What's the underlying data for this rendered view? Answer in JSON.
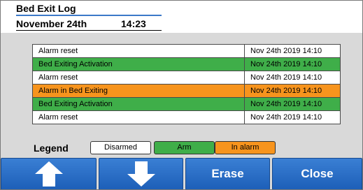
{
  "header": {
    "title": "Bed Exit Log",
    "date": "November 24th",
    "time": "14:23"
  },
  "log": {
    "rows": [
      {
        "event": "Alarm reset",
        "timestamp": "Nov 24th 2019 14:10",
        "status": "disarmed"
      },
      {
        "event": "Bed Exiting Activation",
        "timestamp": "Nov 24th 2019 14:10",
        "status": "arm"
      },
      {
        "event": "Alarm reset",
        "timestamp": "Nov 24th 2019 14:10",
        "status": "disarmed"
      },
      {
        "event": "Alarm in Bed Exiting",
        "timestamp": "Nov 24th 2019 14:10",
        "status": "in_alarm"
      },
      {
        "event": "Bed Exiting Activation",
        "timestamp": "Nov 24th 2019 14:10",
        "status": "arm"
      },
      {
        "event": "Alarm reset",
        "timestamp": "Nov 24th 2019 14:10",
        "status": "disarmed"
      }
    ]
  },
  "legend": {
    "title": "Legend",
    "items": [
      {
        "label": "Disarmed",
        "color": "#ffffff",
        "status": "disarmed"
      },
      {
        "label": "Arm",
        "color": "#3fae49",
        "status": "arm"
      },
      {
        "label": "In alarm",
        "color": "#f7941d",
        "status": "in_alarm"
      }
    ]
  },
  "buttons": {
    "up_icon": "arrow-up-icon",
    "down_icon": "arrow-down-icon",
    "erase_label": "Erase",
    "close_label": "Close",
    "color": "#2468c4"
  }
}
